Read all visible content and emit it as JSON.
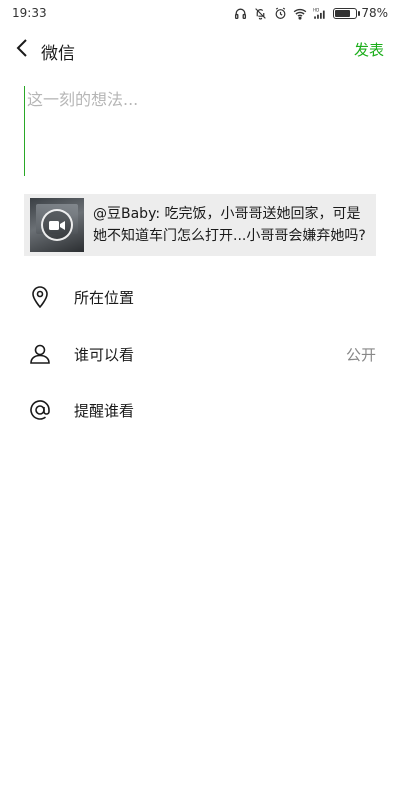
{
  "status_bar": {
    "time": "19:33",
    "battery": "78%",
    "battery_level": 0.78,
    "icons": [
      "headphones-icon",
      "mute-bell-icon",
      "alarm-icon",
      "wifi-icon",
      "hd-signal-icon",
      "battery-icon"
    ]
  },
  "header": {
    "back_icon": "chevron-left-icon",
    "title": "微信",
    "publish_label": "发表",
    "accent_color": "#1aad19"
  },
  "compose": {
    "placeholder": "这一刻的想法...",
    "value": ""
  },
  "shared_item": {
    "thumbnail_icon": "video-camera-icon",
    "text": "@豆Baby: 吃完饭，小哥哥送她回家，可是她不知道车门怎么打开...小哥哥会嫌弃她吗?"
  },
  "options": [
    {
      "icon": "location-pin-icon",
      "label": "所在位置",
      "value": ""
    },
    {
      "icon": "person-icon",
      "label": "谁可以看",
      "value": "公开"
    },
    {
      "icon": "at-sign-icon",
      "label": "提醒谁看",
      "value": ""
    }
  ]
}
